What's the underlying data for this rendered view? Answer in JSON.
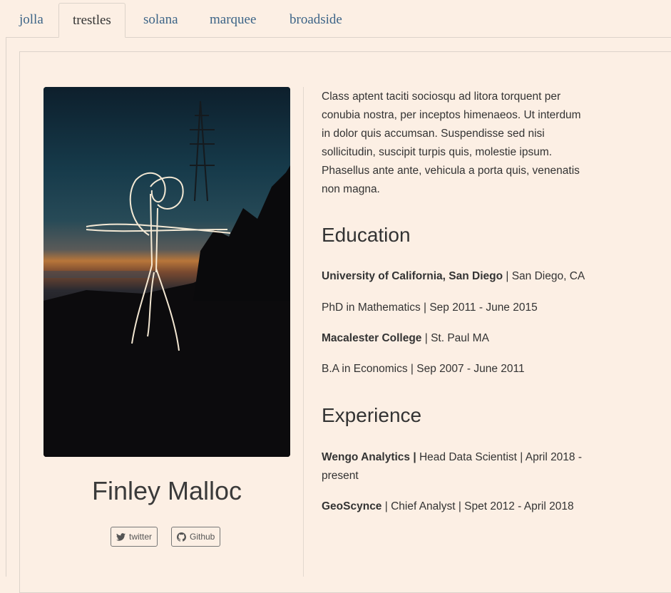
{
  "tabs": [
    "jolla",
    "trestles",
    "solana",
    "marquee",
    "broadside"
  ],
  "active_tab": "trestles",
  "profile": {
    "name": "Finley Malloc",
    "twitter_label": "twitter",
    "github_label": "Github"
  },
  "bio": "Class aptent taciti sociosqu ad litora torquent per conubia nostra, per inceptos himenaeos. Ut interdum in dolor quis accumsan. Suspendisse sed nisi sollicitudin, suscipit turpis quis, molestie ipsum. Phasellus ante ante, vehicula a porta quis, venenatis non magna.",
  "education": {
    "heading": "Education",
    "items": [
      {
        "school": "University of California, San Diego",
        "location": " | San Diego, CA",
        "degree": "PhD in Mathematics | Sep 2011 - June 2015"
      },
      {
        "school": "Macalester College",
        "location": " | St. Paul MA",
        "degree": "B.A in Economics | Sep 2007 - June 2011"
      }
    ]
  },
  "experience": {
    "heading": "Experience",
    "items": [
      {
        "company": "Wengo Analytics |",
        "detail": " Head Data Scientist | April 2018 - present"
      },
      {
        "company": "GeoScynce",
        "detail": " | Chief Analyst | Spet 2012 - April 2018"
      }
    ]
  }
}
